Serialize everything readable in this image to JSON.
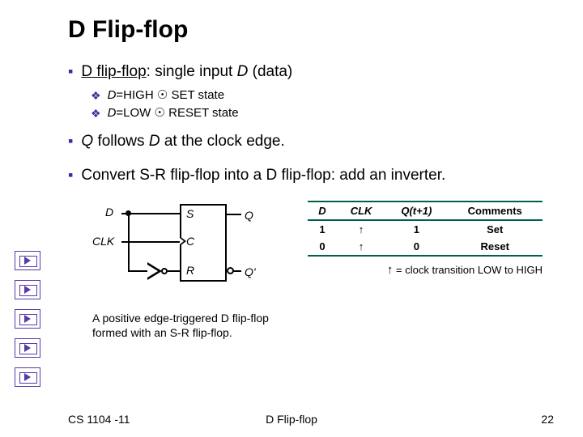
{
  "title": "D Flip-flop",
  "bullets": {
    "b1": {
      "pre": "D flip-flop",
      "post": ": single input ",
      "em": "D",
      "tail": " (data)"
    },
    "b1s1": {
      "pre": "D",
      "mid": "=HIGH ",
      "sym": "☉",
      "post": " SET state"
    },
    "b1s2": {
      "pre": "D",
      "mid": "=LOW ",
      "sym": "☉",
      "post": " RESET state"
    },
    "b2": {
      "pre": "Q",
      "mid": " follows ",
      "em": "D",
      "post": " at the clock edge."
    },
    "b3": "Convert S-R flip-flop into a D flip-flop: add an inverter."
  },
  "circuit": {
    "D": "D",
    "CLK": "CLK",
    "S": "S",
    "C": "C",
    "R": "R",
    "Q": "Q",
    "Qp": "Q'"
  },
  "table": {
    "headers": [
      "D",
      "CLK",
      "Q(t+1)",
      "Comments"
    ],
    "rows": [
      {
        "d": "1",
        "clk": "↑",
        "q": "1",
        "c": "Set"
      },
      {
        "d": "0",
        "clk": "↑",
        "q": "0",
        "c": "Reset"
      }
    ],
    "note_sym": "↑",
    "note_text": " = clock transition LOW to HIGH"
  },
  "caption": "A positive edge-triggered D flip-flop formed with an S-R flip-flop.",
  "footer": {
    "left": "CS 1104 -11",
    "center": "D Flip-flop",
    "right": "22"
  }
}
